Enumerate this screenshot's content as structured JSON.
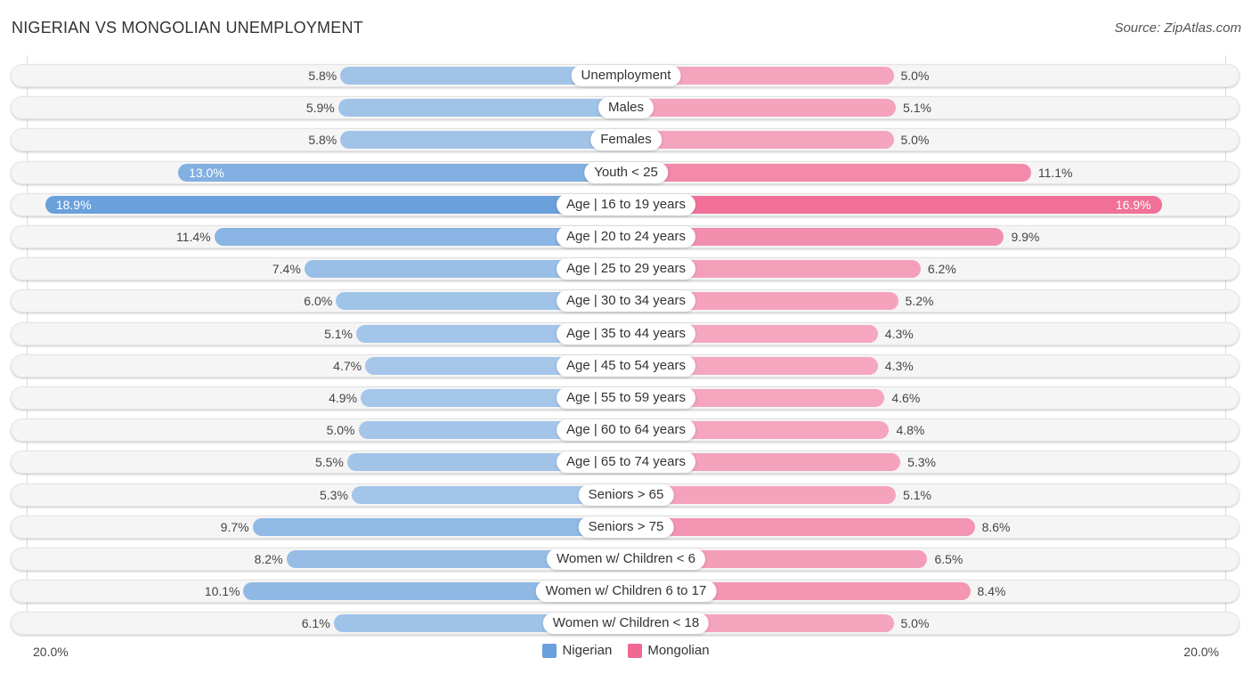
{
  "header": {
    "title": "NIGERIAN VS MONGOLIAN UNEMPLOYMENT",
    "source": "Source: ZipAtlas.com"
  },
  "colors": {
    "nigerian_strong": "#6aa0dc",
    "nigerian_light": "#a8c8ea",
    "mongolian_strong": "#f06892",
    "mongolian_light": "#f5a8c0"
  },
  "chart_data": {
    "type": "bar",
    "orientation": "horizontal-diverging",
    "title": "NIGERIAN VS MONGOLIAN UNEMPLOYMENT",
    "xlabel": "",
    "ylabel": "",
    "xlim": [
      -20,
      20
    ],
    "axis_labels": {
      "left": "20.0%",
      "right": "20.0%"
    },
    "legend": {
      "position": "bottom-center",
      "entries": [
        "Nigerian",
        "Mongolian"
      ]
    },
    "categories": [
      "Unemployment",
      "Males",
      "Females",
      "Youth < 25",
      "Age | 16 to 19 years",
      "Age | 20 to 24 years",
      "Age | 25 to 29 years",
      "Age | 30 to 34 years",
      "Age | 35 to 44 years",
      "Age | 45 to 54 years",
      "Age | 55 to 59 years",
      "Age | 60 to 64 years",
      "Age | 65 to 74 years",
      "Seniors > 65",
      "Seniors > 75",
      "Women w/ Children < 6",
      "Women w/ Children 6 to 17",
      "Women w/ Children < 18"
    ],
    "series": [
      {
        "name": "Nigerian",
        "unit": "%",
        "values": [
          5.8,
          5.9,
          5.8,
          13.0,
          18.9,
          11.4,
          7.4,
          6.0,
          5.1,
          4.7,
          4.9,
          5.0,
          5.5,
          5.3,
          9.7,
          8.2,
          10.1,
          6.1
        ],
        "labels": [
          "5.8%",
          "5.9%",
          "5.8%",
          "13.0%",
          "18.9%",
          "11.4%",
          "7.4%",
          "6.0%",
          "5.1%",
          "4.7%",
          "4.9%",
          "5.0%",
          "5.5%",
          "5.3%",
          "9.7%",
          "8.2%",
          "10.1%",
          "6.1%"
        ]
      },
      {
        "name": "Mongolian",
        "unit": "%",
        "values": [
          5.0,
          5.1,
          5.0,
          11.1,
          16.9,
          9.9,
          6.2,
          5.2,
          4.3,
          4.3,
          4.6,
          4.8,
          5.3,
          5.1,
          8.6,
          6.5,
          8.4,
          5.0
        ],
        "labels": [
          "5.0%",
          "5.1%",
          "5.0%",
          "11.1%",
          "16.9%",
          "9.9%",
          "6.2%",
          "5.2%",
          "4.3%",
          "4.3%",
          "4.6%",
          "4.8%",
          "5.3%",
          "5.1%",
          "8.6%",
          "6.5%",
          "8.4%",
          "5.0%"
        ]
      }
    ]
  }
}
